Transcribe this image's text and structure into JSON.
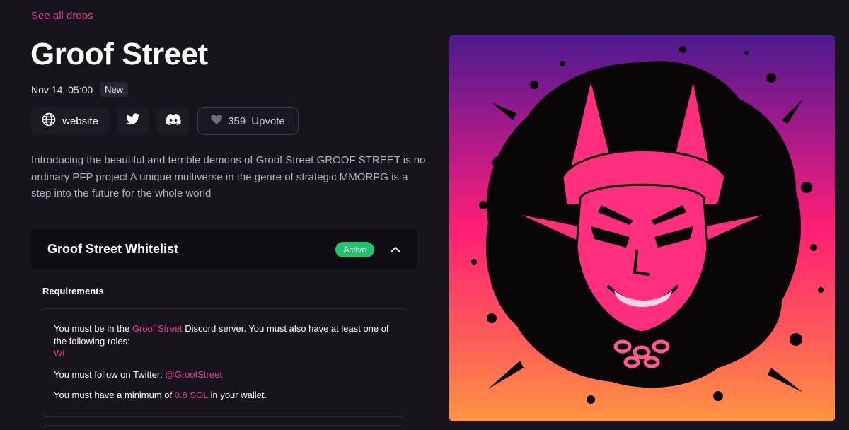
{
  "nav": {
    "back_label": "See all drops"
  },
  "drop": {
    "title": "Groof Street",
    "date": "Nov 14, 05:00",
    "badge": "New"
  },
  "social": {
    "website_label": "website",
    "website_icon": "globe-icon",
    "twitter_icon": "twitter-icon",
    "discord_icon": "discord-icon",
    "upvote_count": "359",
    "upvote_label": "Upvote",
    "upvote_icon": "heart-icon"
  },
  "description": "Introducing the beautiful and terrible demons of Groof Street GROOF STREET is no ordinary PFP project A unique multiverse in the genre of strategic MMORPG is a step into the future for the whole world",
  "whitelist": {
    "title": "Groof Street Whitelist",
    "status": "Active",
    "status_color": "#22c56d",
    "requirements_heading": "Requirements",
    "discord_prefix": "You must be in the ",
    "discord_server": "Groof Street",
    "discord_suffix": " Discord server. You must also have at least one of the following roles:",
    "role": "WL",
    "twitter_prefix": "You must follow on Twitter: ",
    "twitter_handle": "@GroofStreet",
    "wallet_prefix": "You must have a minimum of ",
    "wallet_amount": "0.8 SOL",
    "wallet_suffix": " in your wallet."
  },
  "artwork": {
    "subject": "demon-artwork"
  },
  "colors": {
    "accent": "#e0408f",
    "background": "#17141c",
    "gradient_top": "#4b1a8f",
    "gradient_mid": "#ff1f74",
    "gradient_bottom": "#ff9442"
  }
}
